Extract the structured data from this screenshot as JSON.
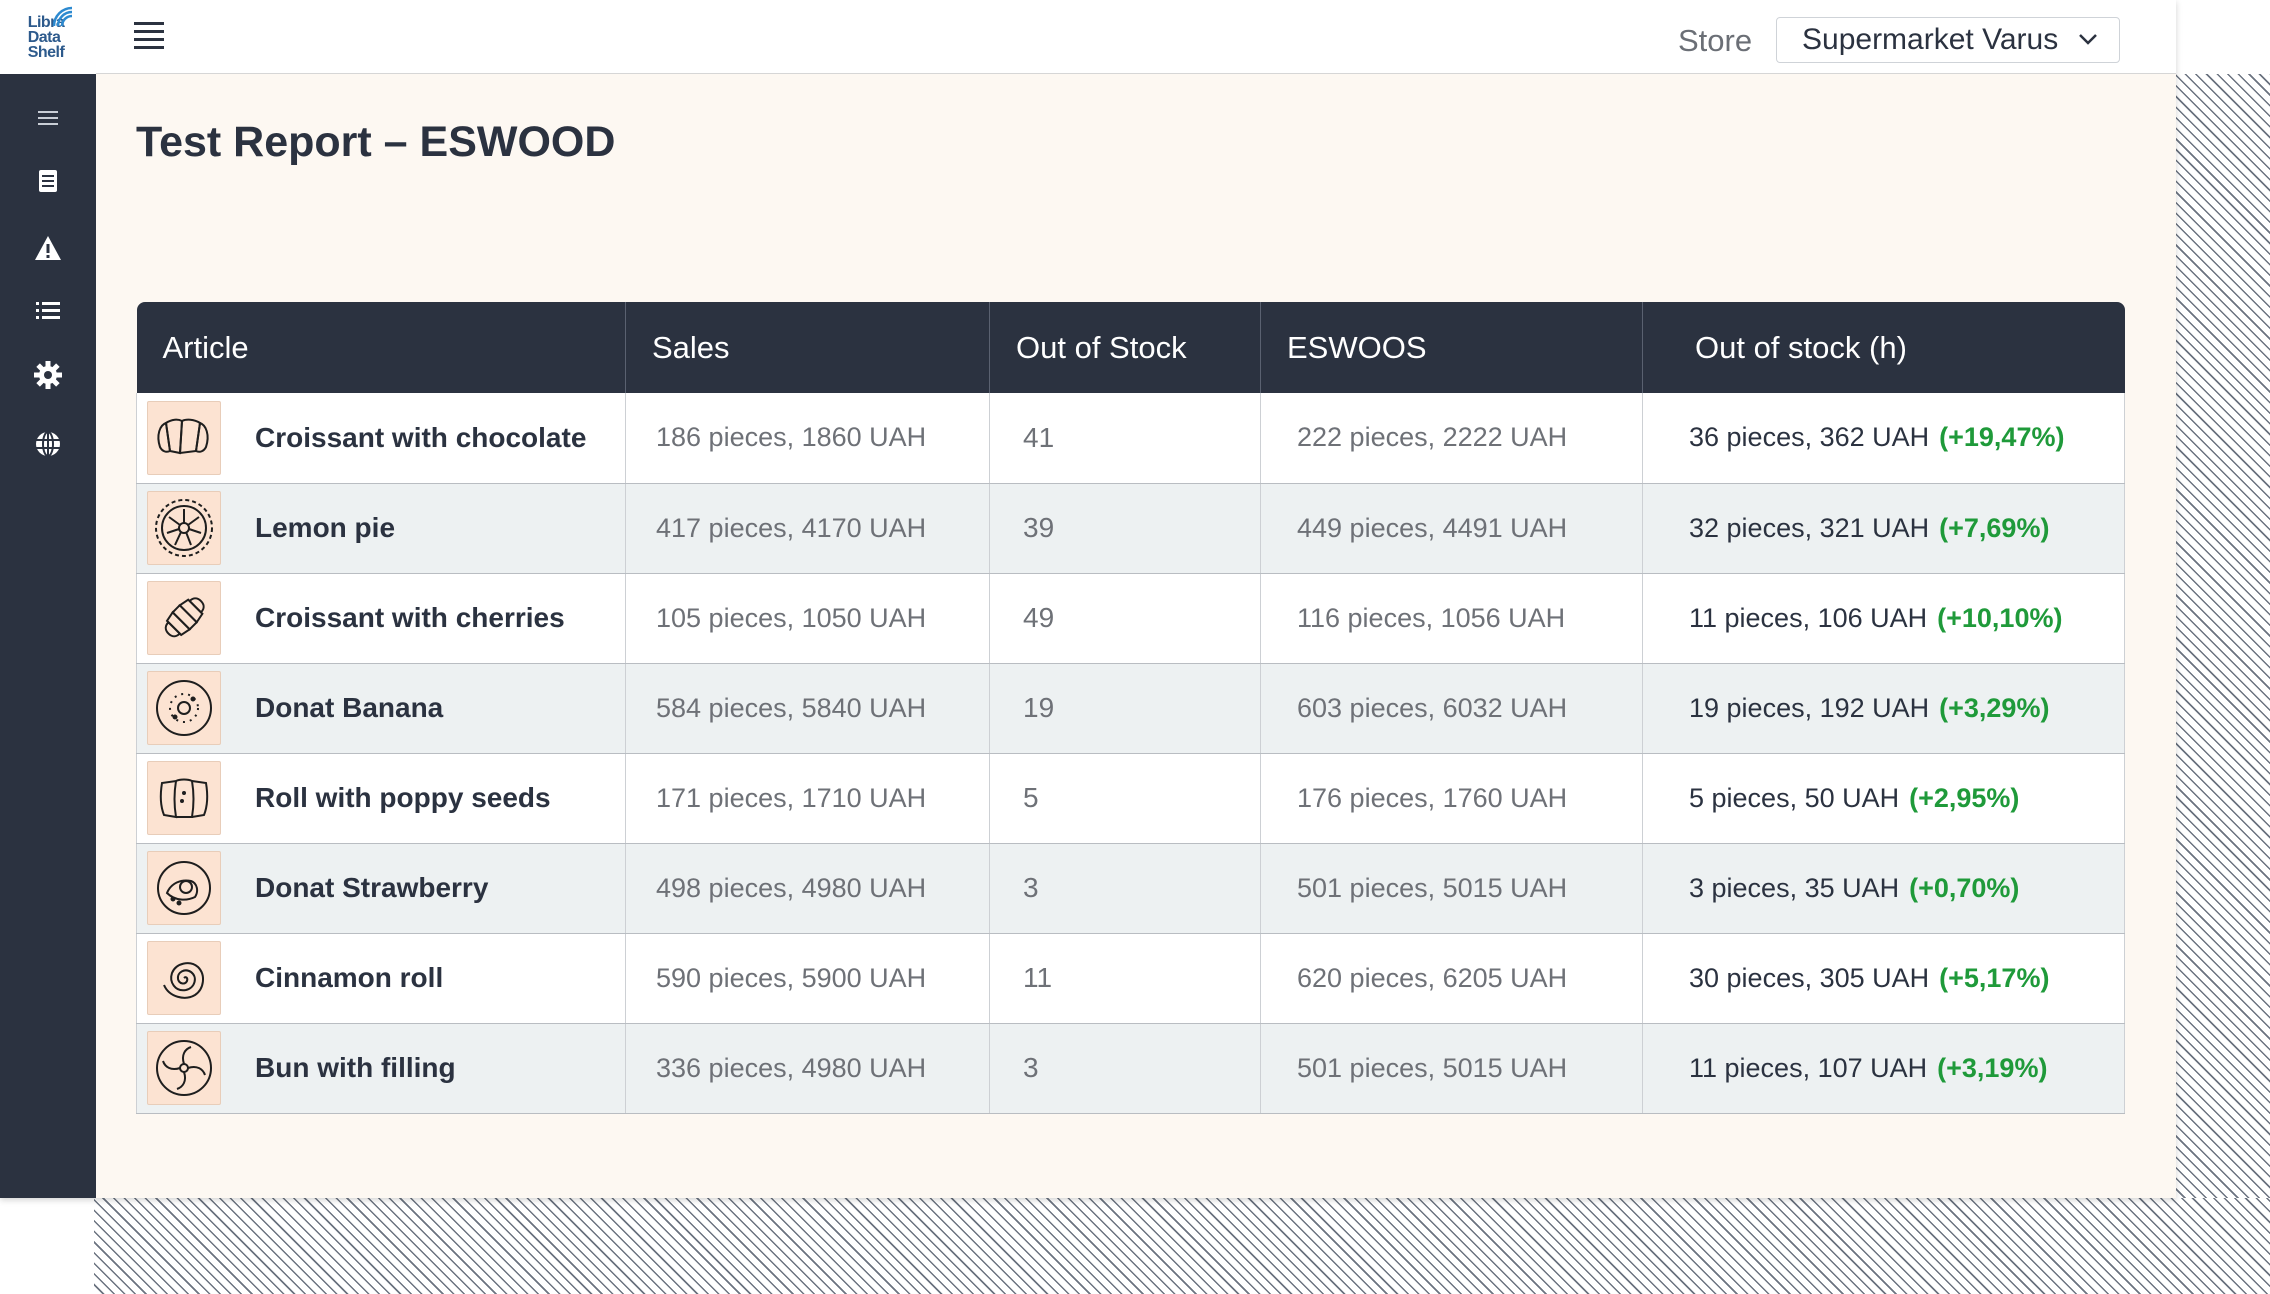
{
  "app": {
    "logo": {
      "line1": "Libra",
      "line2": "Data",
      "line3": "Shelf"
    }
  },
  "sidebar": {
    "items": [
      {
        "name": "menu",
        "icon": "hamburger-icon"
      },
      {
        "name": "reports",
        "icon": "document-icon"
      },
      {
        "name": "alerts",
        "icon": "warning-icon"
      },
      {
        "name": "lists",
        "icon": "list-icon"
      },
      {
        "name": "settings",
        "icon": "gear-icon"
      },
      {
        "name": "language",
        "icon": "globe-icon"
      }
    ]
  },
  "header": {
    "store_label": "Store",
    "store_selected": "Supermarket Varus"
  },
  "page": {
    "title": "Test Report –  ESWOOD"
  },
  "table": {
    "columns": [
      "Article",
      "Sales",
      "Out of Stock",
      "ESWOOS",
      "Out of stock (h)"
    ],
    "rows": [
      {
        "article": "Croissant with chocolate",
        "icon": "croissant-icon",
        "sales": "186 pieces, 1860 UAH",
        "out_of_stock": "41",
        "eswoos": "222 pieces, 2222 UAH",
        "oos_h": "36 pieces, 362 UAH",
        "oos_h_pct": "(+19,47%)"
      },
      {
        "article": "Lemon pie",
        "icon": "pie-icon",
        "sales": "417 pieces, 4170 UAH",
        "out_of_stock": "39",
        "eswoos": "449 pieces, 4491 UAH",
        "oos_h": "32 pieces, 321 UAH",
        "oos_h_pct": "(+7,69%)"
      },
      {
        "article": "Croissant with cherries",
        "icon": "croissant-roll-icon",
        "sales": "105 pieces, 1050 UAH",
        "out_of_stock": "49",
        "eswoos": "116 pieces, 1056 UAH",
        "oos_h": "11 pieces, 106 UAH",
        "oos_h_pct": "(+10,10%)"
      },
      {
        "article": "Donat Banana",
        "icon": "donut-icon",
        "sales": "584 pieces, 5840 UAH",
        "out_of_stock": "19",
        "eswoos": "603 pieces, 6032 UAH",
        "oos_h": "19 pieces, 192 UAH",
        "oos_h_pct": "(+3,29%)"
      },
      {
        "article": "Roll with poppy seeds",
        "icon": "bread-roll-icon",
        "sales": "171 pieces, 1710 UAH",
        "out_of_stock": "5",
        "eswoos": "176 pieces, 1760 UAH",
        "oos_h": "5 pieces, 50 UAH",
        "oos_h_pct": "(+2,95%)"
      },
      {
        "article": "Donat Strawberry",
        "icon": "donut-bitten-icon",
        "sales": "498 pieces, 4980 UAH",
        "out_of_stock": "3",
        "eswoos": "501 pieces, 5015 UAH",
        "oos_h": "3 pieces, 35 UAH",
        "oos_h_pct": "(+0,70%)"
      },
      {
        "article": "Cinnamon roll",
        "icon": "cinnamon-roll-icon",
        "sales": "590 pieces, 5900 UAH",
        "out_of_stock": "11",
        "eswoos": "620 pieces, 6205 UAH",
        "oos_h": "30 pieces, 305 UAH",
        "oos_h_pct": "(+5,17%)"
      },
      {
        "article": "Bun with filling",
        "icon": "bun-swirl-icon",
        "sales": "336 pieces, 4980 UAH",
        "out_of_stock": "3",
        "eswoos": "501 pieces, 5015 UAH",
        "oos_h": "11 pieces, 107 UAH",
        "oos_h_pct": "(+3,19%)"
      }
    ]
  },
  "colors": {
    "sidebar_bg": "#2b3240",
    "header_row_bg": "#2b3240",
    "page_bg": "#fdf8f2",
    "thumb_bg": "#fce3d2",
    "positive": "#1f9a3a",
    "logo_blue": "#2d5a8c"
  }
}
